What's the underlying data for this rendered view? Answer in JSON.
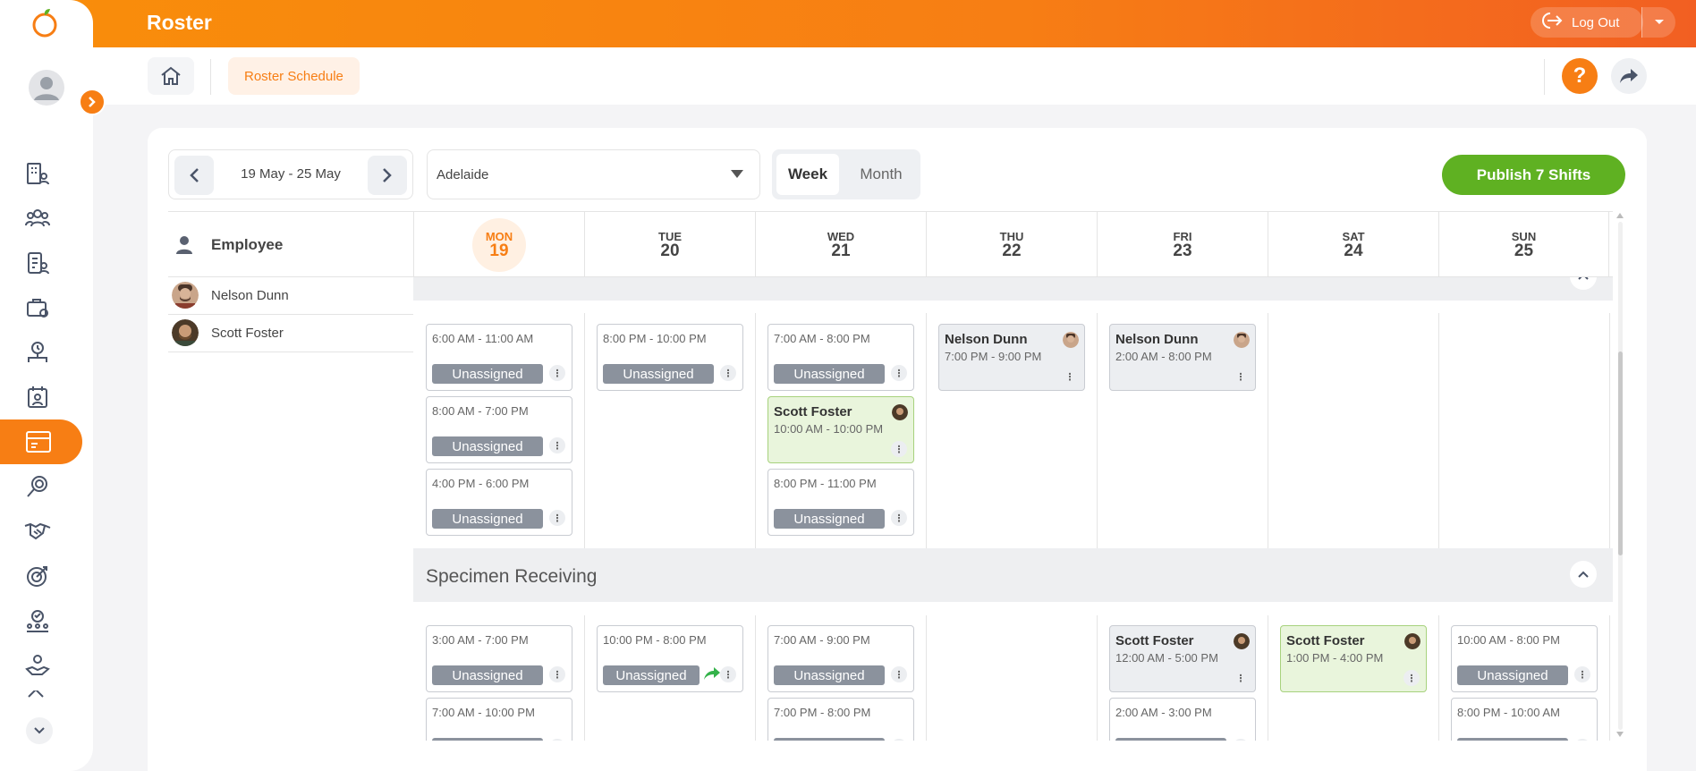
{
  "app": {
    "title": "Roster",
    "logout_label": "Log Out"
  },
  "header": {
    "breadcrumb": "Roster Schedule",
    "help_label": "?"
  },
  "toolbar": {
    "date_range": "19 May - 25 May",
    "location": "Adelaide",
    "view_week": "Week",
    "view_month": "Month",
    "publish_label": "Publish 7 Shifts"
  },
  "employee_header": "Employee",
  "employees": [
    {
      "name": "Nelson Dunn"
    },
    {
      "name": "Scott Foster"
    }
  ],
  "days": [
    {
      "dow": "MON",
      "num": "19"
    },
    {
      "dow": "TUE",
      "num": "20"
    },
    {
      "dow": "WED",
      "num": "21"
    },
    {
      "dow": "THU",
      "num": "22"
    },
    {
      "dow": "FRI",
      "num": "23"
    },
    {
      "dow": "SAT",
      "num": "24"
    },
    {
      "dow": "SUN",
      "num": "25"
    }
  ],
  "sections": [
    {
      "title": ""
    },
    {
      "title": "Specimen Receiving"
    }
  ],
  "unassigned_label": "Unassigned",
  "shifts_top": {
    "mon": [
      {
        "time": "6:00 AM - 11:00 AM"
      },
      {
        "time": "8:00 AM - 7:00 PM"
      },
      {
        "time": "4:00 PM - 6:00 PM"
      }
    ],
    "tue": [
      {
        "time": "8:00 PM - 10:00 PM"
      }
    ],
    "wed": [
      {
        "time": "7:00 AM - 8:00 PM"
      },
      {
        "who": "Scott Foster",
        "time": "10:00 AM - 10:00 PM"
      },
      {
        "time": "8:00 PM - 11:00 PM"
      }
    ],
    "thu": [
      {
        "who": "Nelson Dunn",
        "time": "7:00 PM - 9:00 PM"
      }
    ],
    "fri": [
      {
        "who": "Nelson Dunn",
        "time": "2:00 AM - 8:00 PM"
      }
    ]
  },
  "shifts_bottom": {
    "mon": [
      {
        "time": "3:00 AM - 7:00 PM"
      },
      {
        "time": "7:00 AM - 10:00 PM"
      }
    ],
    "tue": [
      {
        "time": "10:00 PM - 8:00 PM"
      }
    ],
    "wed": [
      {
        "time": "7:00 AM - 9:00 PM"
      },
      {
        "time": "7:00 PM - 8:00 PM"
      }
    ],
    "fri": [
      {
        "who": "Scott Foster",
        "time": "12:00 AM - 5:00 PM"
      },
      {
        "time": "2:00 AM - 3:00 PM"
      }
    ],
    "sat": [
      {
        "who": "Scott Foster",
        "time": "1:00 PM - 4:00 PM"
      }
    ],
    "sun": [
      {
        "time": "10:00 AM - 8:00 PM"
      },
      {
        "time": "8:00 PM - 10:00 AM"
      }
    ]
  },
  "colors": {
    "accent": "#f77e14",
    "publish": "#5fb122",
    "unassigned": "#8b929d",
    "assigned_green": "#e9f5dc"
  }
}
